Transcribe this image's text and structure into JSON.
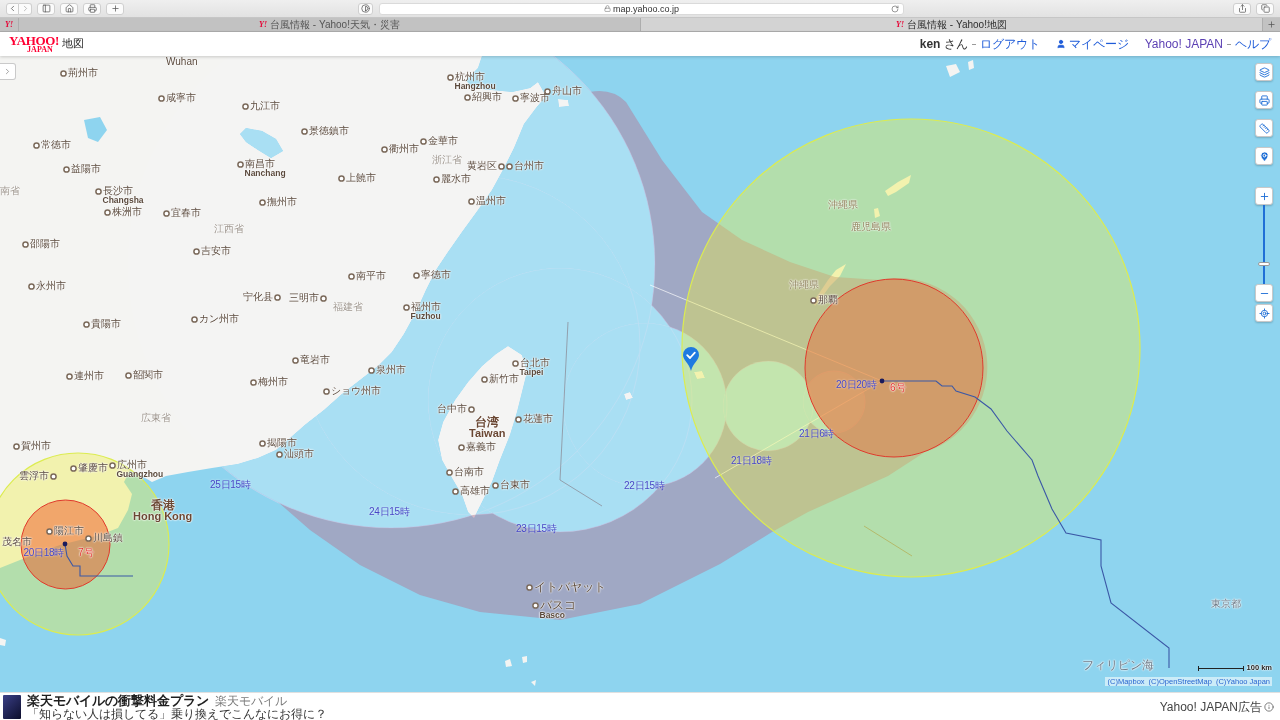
{
  "browser": {
    "url": "map.yahoo.co.jp",
    "pinned_tab": {
      "favicon": "Y!"
    },
    "tabs": [
      {
        "favicon": "Y!",
        "title": "台風情報 - Yahoo!天気・災害",
        "selected": false
      },
      {
        "favicon": "Y!",
        "title": "台風情報 - Yahoo!地図",
        "selected": true
      }
    ]
  },
  "header": {
    "logo": {
      "wordmark": "YAHOO!",
      "subtitle": "JAPAN",
      "service": "地図"
    },
    "nav": [
      {
        "kind": "user",
        "label": "**ken** さん"
      },
      {
        "kind": "link",
        "label": "ログアウト"
      },
      {
        "kind": "mypage",
        "label": "マイページ"
      },
      {
        "kind": "link",
        "label": "Yahoo! JAPAN"
      },
      {
        "kind": "link",
        "label": "ヘルプ"
      }
    ]
  },
  "map": {
    "places": [
      {
        "kind": "place",
        "name": "Wuhan"
      },
      {
        "kind": "city",
        "name": "荊州市"
      },
      {
        "kind": "city",
        "name": "杭州市",
        "name_en": "Hangzhou"
      },
      {
        "kind": "city",
        "name": "咸寧市"
      },
      {
        "kind": "city",
        "name": "紹興市"
      },
      {
        "kind": "city",
        "name": "寧波市"
      },
      {
        "kind": "city",
        "name": "舟山市"
      },
      {
        "kind": "city",
        "name": "九江市"
      },
      {
        "kind": "city",
        "name": "景徳鎮市"
      },
      {
        "kind": "city",
        "name": "常徳市"
      },
      {
        "kind": "city",
        "name": "衢州市"
      },
      {
        "kind": "city",
        "name": "金華市"
      },
      {
        "kind": "city",
        "name": "益陽市"
      },
      {
        "kind": "city",
        "name": "南昌市",
        "name_en": "Nanchang"
      },
      {
        "kind": "province",
        "name": "浙江省"
      },
      {
        "kind": "city",
        "name": "黄岩区"
      },
      {
        "kind": "city",
        "name": "台州市"
      },
      {
        "kind": "city",
        "name": "上饒市"
      },
      {
        "kind": "city",
        "name": "麗水市"
      },
      {
        "kind": "province",
        "name": "南省"
      },
      {
        "kind": "city",
        "name": "長沙市",
        "name_en": "Changsha"
      },
      {
        "kind": "city",
        "name": "撫州市"
      },
      {
        "kind": "city",
        "name": "温州市"
      },
      {
        "kind": "city",
        "name": "株洲市"
      },
      {
        "kind": "city",
        "name": "宜春市"
      },
      {
        "kind": "province",
        "name": "江西省"
      },
      {
        "kind": "city",
        "name": "邵陽市"
      },
      {
        "kind": "city",
        "name": "吉安市"
      },
      {
        "kind": "city",
        "name": "南平市"
      },
      {
        "kind": "city",
        "name": "寧徳市"
      },
      {
        "kind": "city",
        "name": "永州市"
      },
      {
        "kind": "city",
        "name": "宁化县"
      },
      {
        "kind": "city",
        "name": "三明市"
      },
      {
        "kind": "city",
        "name": "貴陽市"
      },
      {
        "kind": "city",
        "name": "カン州市"
      },
      {
        "kind": "province",
        "name": "福建省"
      },
      {
        "kind": "city",
        "name": "福州市",
        "name_en": "Fuzhou"
      },
      {
        "kind": "city",
        "name": "連州市"
      },
      {
        "kind": "city",
        "name": "韶関市"
      },
      {
        "kind": "city",
        "name": "梅州市"
      },
      {
        "kind": "city",
        "name": "竜岩市"
      },
      {
        "kind": "city",
        "name": "ショウ州市"
      },
      {
        "kind": "city",
        "name": "泉州市"
      },
      {
        "kind": "city",
        "name": "新竹市"
      },
      {
        "kind": "city",
        "name": "台北市",
        "name_en": "Taipei"
      },
      {
        "kind": "province",
        "name": "広東省"
      },
      {
        "kind": "city",
        "name": "台中市"
      },
      {
        "kind": "region",
        "name": "台湾",
        "name_en": "Taiwan"
      },
      {
        "kind": "city",
        "name": "花蓮市"
      },
      {
        "kind": "city",
        "name": "賀州市"
      },
      {
        "kind": "city",
        "name": "揭陽市"
      },
      {
        "kind": "city",
        "name": "汕頭市"
      },
      {
        "kind": "city",
        "name": "嘉義市"
      },
      {
        "kind": "city",
        "name": "雲浮市"
      },
      {
        "kind": "city",
        "name": "肇慶市"
      },
      {
        "kind": "city",
        "name": "広州市",
        "name_en": "Guangzhou"
      },
      {
        "kind": "city",
        "name": "台南市"
      },
      {
        "kind": "city",
        "name": "高雄市"
      },
      {
        "kind": "city",
        "name": "台東市"
      },
      {
        "kind": "region",
        "name": "香港",
        "name_en": "Hong Kong"
      },
      {
        "kind": "city",
        "name": "陽江市"
      },
      {
        "kind": "place",
        "name": "茂名市"
      },
      {
        "kind": "city",
        "name": "川島鎮"
      },
      {
        "kind": "city",
        "name": "イトバヤット"
      },
      {
        "kind": "city",
        "name": "バスコ",
        "name_en": "Basco"
      }
    ],
    "east_places": [
      {
        "kind": "prefecture",
        "name": "沖縄県"
      },
      {
        "kind": "prefecture",
        "name": "鹿児島県"
      },
      {
        "kind": "prefecture",
        "name": "沖縄県"
      },
      {
        "kind": "city",
        "name": "那覇"
      },
      {
        "kind": "sea",
        "name": "東京都"
      },
      {
        "kind": "sea",
        "name": "フィリピン海"
      }
    ],
    "typhoons": [
      {
        "number": "6号",
        "time": "20日20時",
        "forecast": [
          {
            "time": "21日6時"
          },
          {
            "time": "21日18時"
          },
          {
            "time": "22日15時"
          },
          {
            "time": "23日15時"
          },
          {
            "time": "24日15時"
          },
          {
            "time": "25日15時"
          }
        ]
      },
      {
        "number": "7号",
        "time": "20日18時"
      }
    ],
    "zoom": {
      "level": 0.24
    },
    "scale": "100 km",
    "attribution": [
      "(C)Mapbox",
      "(C)OpenStreetMap",
      "(C)Yahoo Japan"
    ]
  },
  "ad": {
    "title": "楽天モバイルの衝撃料金プラン",
    "advertiser": "楽天モバイル",
    "text": "「知らない人は損してる」乗り換えでこんなにお得に？",
    "label": "Yahoo! JAPAN広告"
  }
}
